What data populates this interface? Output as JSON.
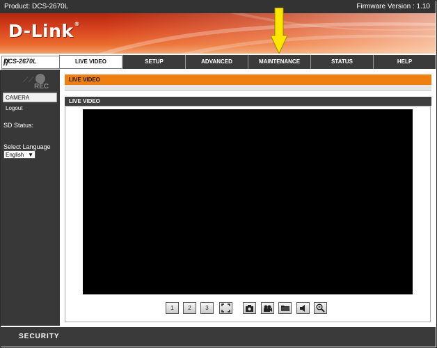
{
  "header": {
    "product": "Product: DCS-2670L",
    "firmware": "Firmware Version : 1.10",
    "logo": "D-Link",
    "logo_mark": "®"
  },
  "model_label": "DCS-2670L",
  "tabs": [
    {
      "label": "LIVE VIDEO",
      "active": true
    },
    {
      "label": "SETUP",
      "active": false
    },
    {
      "label": "ADVANCED",
      "active": false
    },
    {
      "label": "MAINTENANCE",
      "active": false
    },
    {
      "label": "STATUS",
      "active": false
    },
    {
      "label": "HELP",
      "active": false
    }
  ],
  "sidebar": {
    "rec_label": "REC",
    "camera": "CAMERA",
    "logout": "Logout",
    "sd_status": "SD Status:",
    "select_language": "Select Language",
    "language_value": "English"
  },
  "main": {
    "section_title": "LIVE VIDEO",
    "panel_title": "LIVE VIDEO"
  },
  "toolbar": [
    {
      "icon": "profile-1-icon",
      "label": "1"
    },
    {
      "icon": "profile-2-icon",
      "label": "2"
    },
    {
      "icon": "profile-3-icon",
      "label": "3"
    },
    {
      "icon": "fullscreen-icon",
      "label": ""
    },
    {
      "icon": "snapshot-icon",
      "label": ""
    },
    {
      "icon": "record-icon",
      "label": ""
    },
    {
      "icon": "folder-icon",
      "label": ""
    },
    {
      "icon": "audio-icon",
      "label": ""
    },
    {
      "icon": "zoom-icon",
      "label": ""
    }
  ],
  "footer": {
    "label": "SECURITY"
  },
  "colors": {
    "accent": "#f07f11",
    "dark": "#383838",
    "banner": "#d9461f",
    "arrow": "#ffe600"
  }
}
